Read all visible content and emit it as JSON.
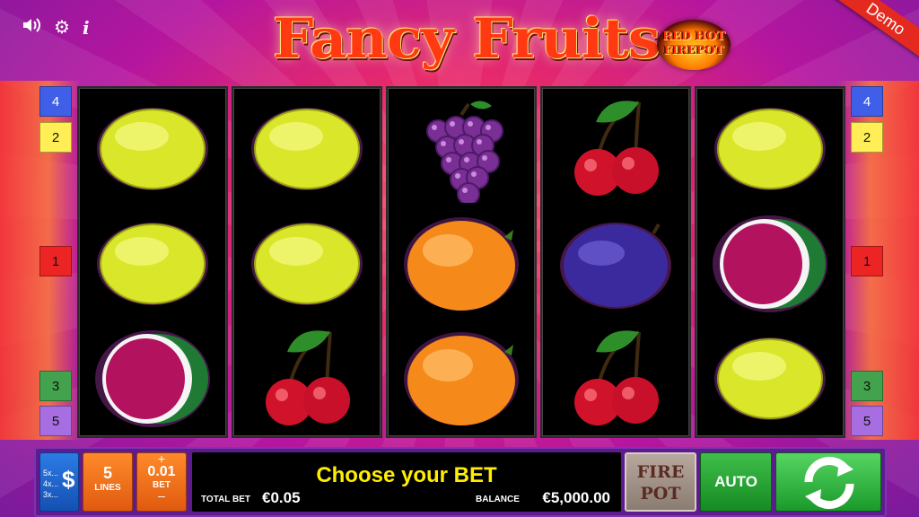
{
  "header": {
    "title": "Fancy Fruits",
    "logo_line1": "RED HOT",
    "logo_line2": "FIREPOT",
    "ribbon": "Demo",
    "icons": [
      "speaker-icon",
      "gear-icon",
      "info-icon"
    ],
    "info_glyph": "i"
  },
  "paylines": {
    "left": [
      "4",
      "2",
      "1",
      "3",
      "5"
    ],
    "right": [
      "4",
      "2",
      "1",
      "3",
      "5"
    ]
  },
  "reels": [
    [
      "lemon",
      "lemon",
      "watermelon"
    ],
    [
      "lemon",
      "lemon",
      "cherry"
    ],
    [
      "grapes",
      "orange",
      "orange"
    ],
    [
      "cherry",
      "plum",
      "cherry"
    ],
    [
      "lemon",
      "watermelon",
      "lemon"
    ]
  ],
  "controls": {
    "currency_rows": [
      "5x...",
      "4x...",
      "3x..."
    ],
    "currency_symbol": "$",
    "lines_value": "5",
    "lines_label": "LINES",
    "bet_plus": "+",
    "bet_value": "0.01",
    "bet_label": "BET",
    "bet_minus": "–",
    "message": "Choose your BET",
    "total_bet_label": "TOTAL BET",
    "total_bet_value": "€0.05",
    "balance_label": "BALANCE",
    "balance_value": "€5,000.00",
    "firepot_line1": "FIRE",
    "firepot_line2": "POT",
    "auto_label": "AUTO"
  },
  "colors": {
    "title": "#ff3a12",
    "message": "#ffee00",
    "panel": "#5e1b8f",
    "auto": "#1e9a2c",
    "spin": "#2fb53c"
  }
}
